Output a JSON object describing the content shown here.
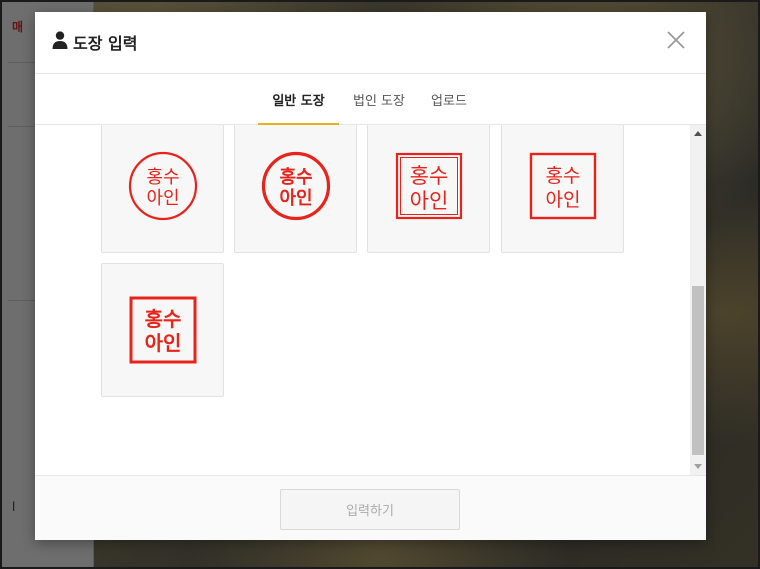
{
  "background": {
    "side_label": "매",
    "side_mark": "l"
  },
  "modal": {
    "title": "도장 입력",
    "header_icon": "user-icon",
    "close_icon": "close-icon"
  },
  "tabs": [
    {
      "label": "일반 도장",
      "active": true
    },
    {
      "label": "법인 도장",
      "active": false
    },
    {
      "label": "업로드",
      "active": false
    }
  ],
  "stamps": [
    {
      "style": "circle-thin",
      "line1": "홍수",
      "line2": "아인"
    },
    {
      "style": "circle-bold",
      "line1": "홍수",
      "line2": "아인"
    },
    {
      "style": "square-seal",
      "line1": "홍수",
      "line2": "아인"
    },
    {
      "style": "square-thin",
      "line1": "홍수",
      "line2": "아인"
    },
    {
      "style": "square-bold",
      "line1": "홍수",
      "line2": "아인"
    }
  ],
  "footer": {
    "submit_label": "입력하기"
  },
  "colors": {
    "accent": "#e6b31e",
    "stamp_red": "#e8231b"
  }
}
